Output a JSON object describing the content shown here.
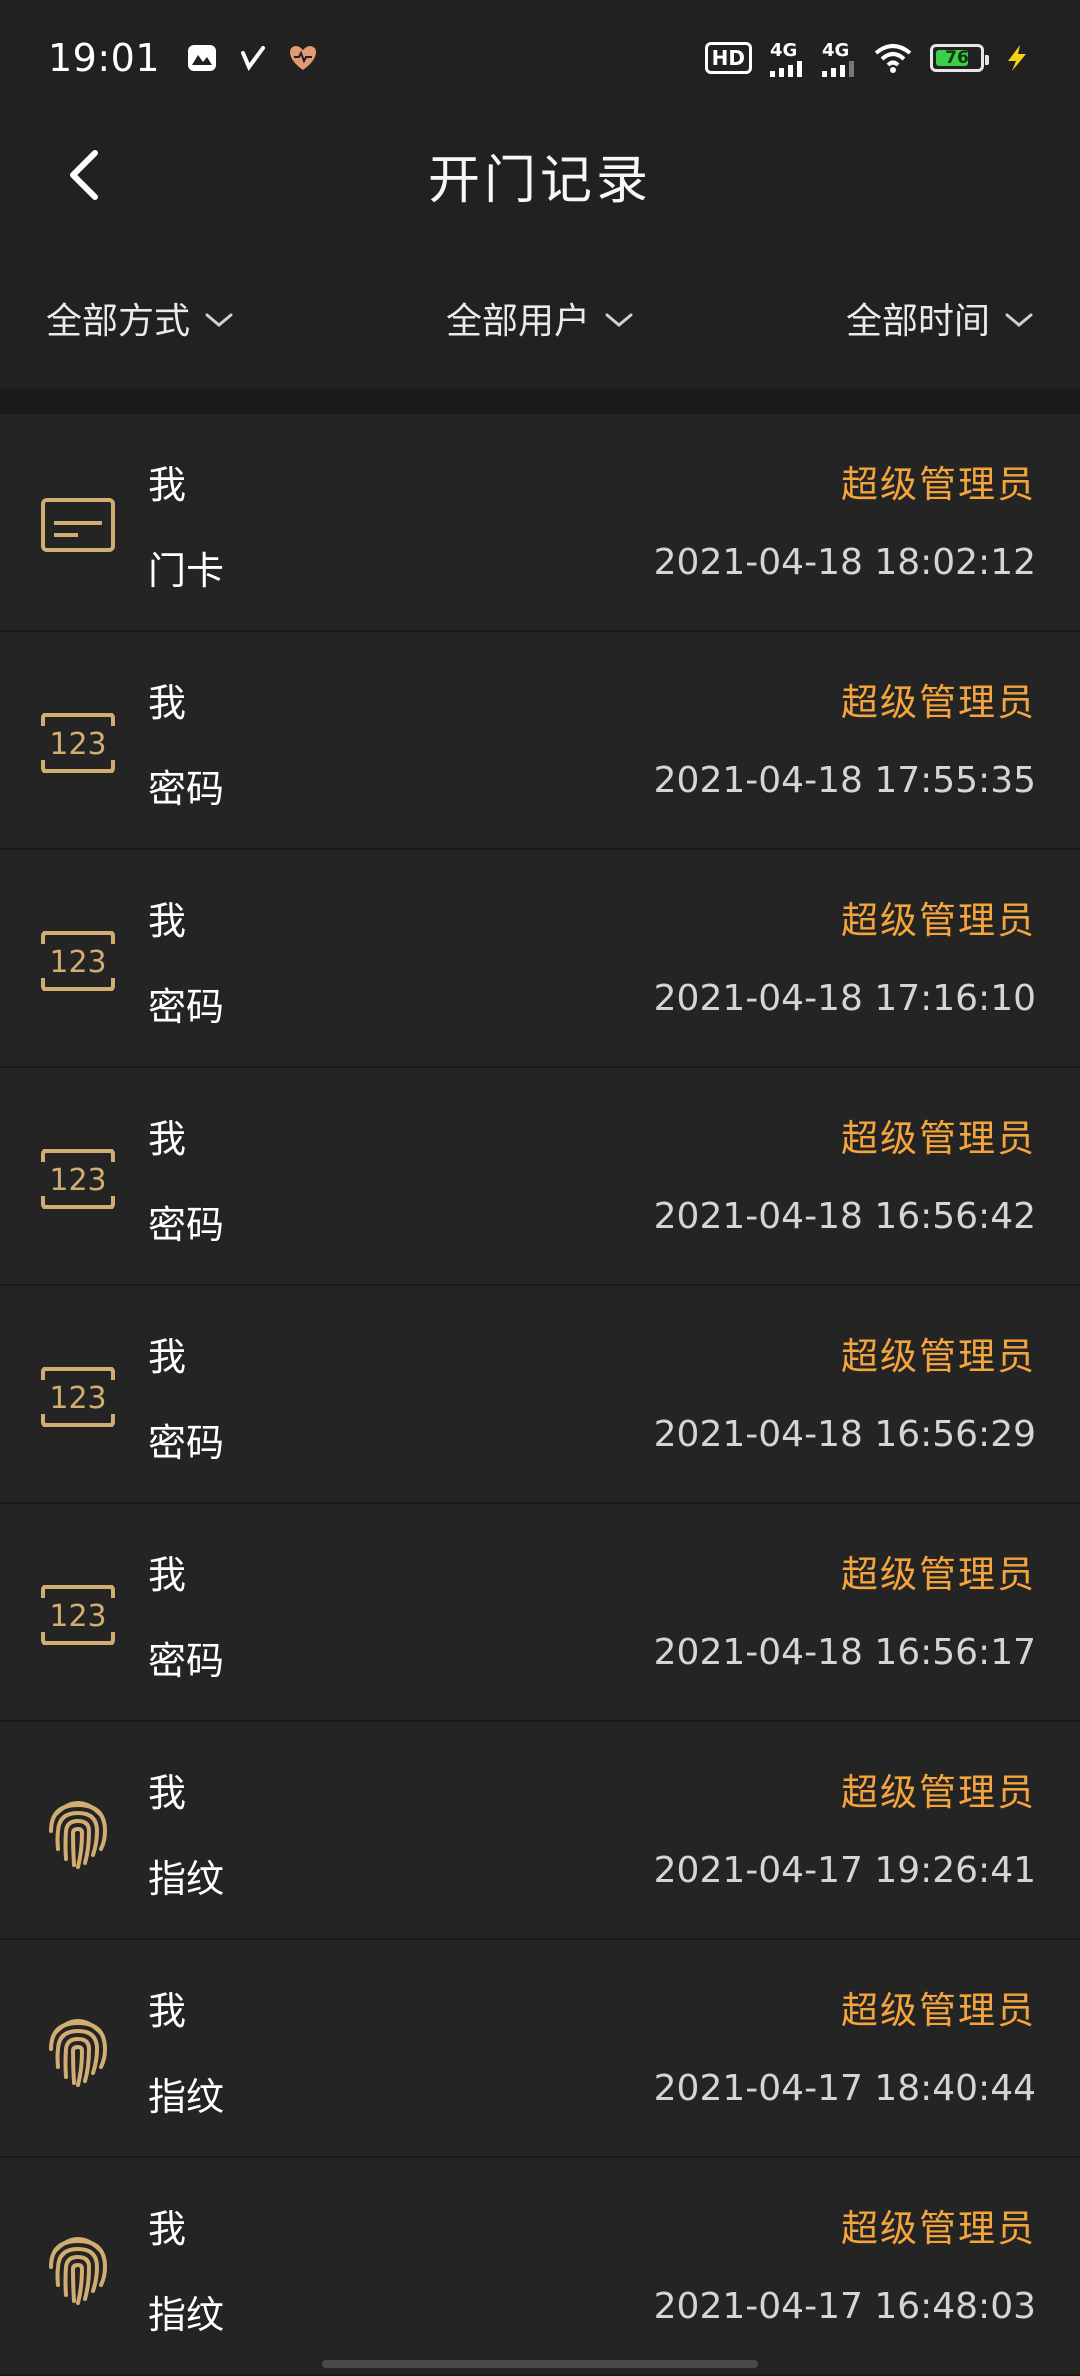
{
  "status_bar": {
    "time": "19:01",
    "hd_label": "HD",
    "net1": "4G",
    "net2": "4G",
    "battery": "76",
    "battery_level": 0.76,
    "icons": [
      "gallery-icon",
      "checkmark-app-icon",
      "health-heart-icon",
      "hd-call-icon",
      "signal-icon",
      "wifi-icon",
      "battery-icon",
      "charging-icon"
    ]
  },
  "header": {
    "title": "开门记录",
    "back_icon": "chevron-left-icon"
  },
  "filters": [
    {
      "label": "全部方式",
      "icon": "chevron-down-icon"
    },
    {
      "label": "全部用户",
      "icon": "chevron-down-icon"
    },
    {
      "label": "全部时间",
      "icon": "chevron-down-icon"
    }
  ],
  "colors": {
    "background": "#212122",
    "accent": "#f3a43c",
    "icon_gold": "#d2ad72"
  },
  "records": [
    {
      "user": "我",
      "method": "门卡",
      "role": "超级管理员",
      "time": "2021-04-18 18:02:12",
      "icon": "card-icon"
    },
    {
      "user": "我",
      "method": "密码",
      "role": "超级管理员",
      "time": "2021-04-18 17:55:35",
      "icon": "password-123-icon"
    },
    {
      "user": "我",
      "method": "密码",
      "role": "超级管理员",
      "time": "2021-04-18 17:16:10",
      "icon": "password-123-icon"
    },
    {
      "user": "我",
      "method": "密码",
      "role": "超级管理员",
      "time": "2021-04-18 16:56:42",
      "icon": "password-123-icon"
    },
    {
      "user": "我",
      "method": "密码",
      "role": "超级管理员",
      "time": "2021-04-18 16:56:29",
      "icon": "password-123-icon"
    },
    {
      "user": "我",
      "method": "密码",
      "role": "超级管理员",
      "time": "2021-04-18 16:56:17",
      "icon": "password-123-icon"
    },
    {
      "user": "我",
      "method": "指纹",
      "role": "超级管理员",
      "time": "2021-04-17 19:26:41",
      "icon": "fingerprint-icon"
    },
    {
      "user": "我",
      "method": "指纹",
      "role": "超级管理员",
      "time": "2021-04-17 18:40:44",
      "icon": "fingerprint-icon"
    },
    {
      "user": "我",
      "method": "指纹",
      "role": "超级管理员",
      "time": "2021-04-17 16:48:03",
      "icon": "fingerprint-icon"
    }
  ]
}
